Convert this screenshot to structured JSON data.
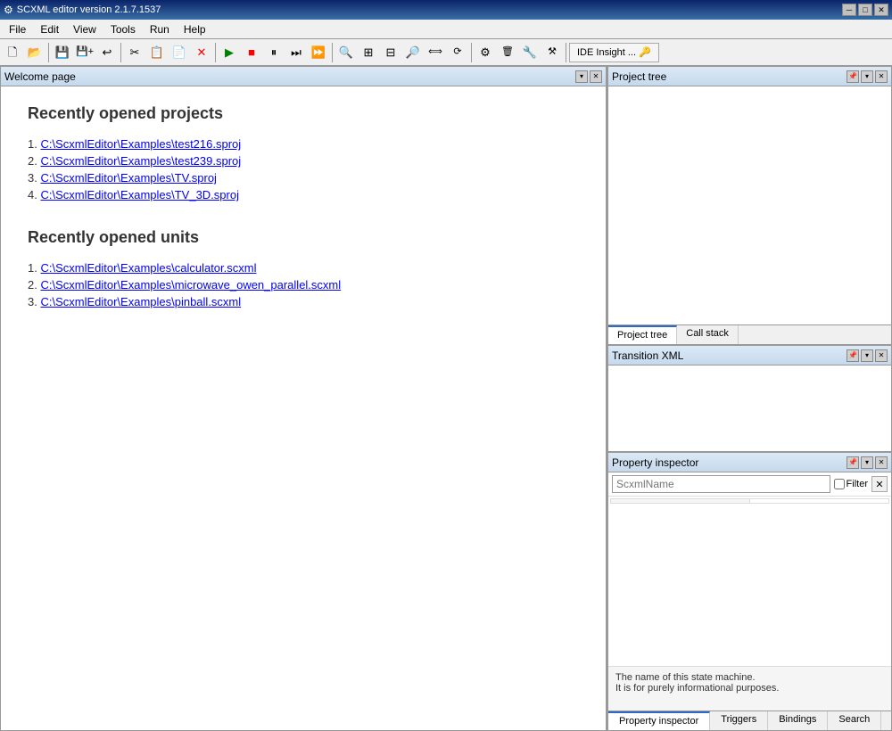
{
  "titlebar": {
    "title": "SCXML editor version 2.1.7.1537",
    "min_btn": "─",
    "max_btn": "□",
    "close_btn": "✕"
  },
  "menubar": {
    "items": [
      {
        "label": "File"
      },
      {
        "label": "Edit"
      },
      {
        "label": "View"
      },
      {
        "label": "Tools"
      },
      {
        "label": "Run"
      },
      {
        "label": "Help"
      }
    ]
  },
  "toolbar": {
    "ide_insight_label": "IDE Insight ...",
    "buttons": [
      {
        "name": "new-btn",
        "icon": "🗋"
      },
      {
        "name": "open-btn",
        "icon": "📂"
      },
      {
        "name": "save-btn",
        "icon": "💾"
      },
      {
        "name": "save-all-btn",
        "icon": "💾"
      },
      {
        "name": "revert-btn",
        "icon": "↩"
      },
      {
        "name": "cut-btn",
        "icon": "✂"
      },
      {
        "name": "copy-btn",
        "icon": "📋"
      },
      {
        "name": "paste-btn",
        "icon": "📄"
      },
      {
        "name": "delete-btn",
        "icon": "✕"
      },
      {
        "name": "run-btn",
        "icon": "▶"
      },
      {
        "name": "stop-btn",
        "icon": "■"
      },
      {
        "name": "pause-btn",
        "icon": "⏸"
      },
      {
        "name": "step-btn",
        "icon": "⏭"
      }
    ]
  },
  "welcome_page": {
    "tab_label": "Welcome page",
    "recently_opened_projects_heading": "Recently opened projects",
    "projects": [
      {
        "num": "1.",
        "path": "C:\\ScxmlEditor\\Examples\\test216.sproj"
      },
      {
        "num": "2.",
        "path": "C:\\ScxmlEditor\\Examples\\test239.sproj"
      },
      {
        "num": "3.",
        "path": "C:\\ScxmlEditor\\Examples\\TV.sproj"
      },
      {
        "num": "4.",
        "path": "C:\\ScxmlEditor\\Examples\\TV_3D.sproj"
      }
    ],
    "recently_opened_units_heading": "Recently opened units",
    "units": [
      {
        "num": "1.",
        "path": "C:\\ScxmlEditor\\Examples\\calculator.scxml"
      },
      {
        "num": "2.",
        "path": "C:\\ScxmlEditor\\Examples\\microwave_owen_parallel.scxml"
      },
      {
        "num": "3.",
        "path": "C:\\ScxmlEditor\\Examples\\pinball.scxml"
      }
    ]
  },
  "project_tree": {
    "panel_label": "Project tree",
    "tab_project_tree": "Project tree",
    "tab_call_stack": "Call stack"
  },
  "transition_xml": {
    "panel_label": "Transition XML"
  },
  "property_inspector": {
    "panel_label": "Property inspector",
    "search_placeholder": "ScxmlName",
    "filter_label": "Filter",
    "description_line1": "The name of this state machine.",
    "description_line2": "It is for purely informational purposes.",
    "tabs": [
      {
        "label": "Property inspector"
      },
      {
        "label": "Triggers"
      },
      {
        "label": "Bindings"
      },
      {
        "label": "Search"
      }
    ]
  }
}
